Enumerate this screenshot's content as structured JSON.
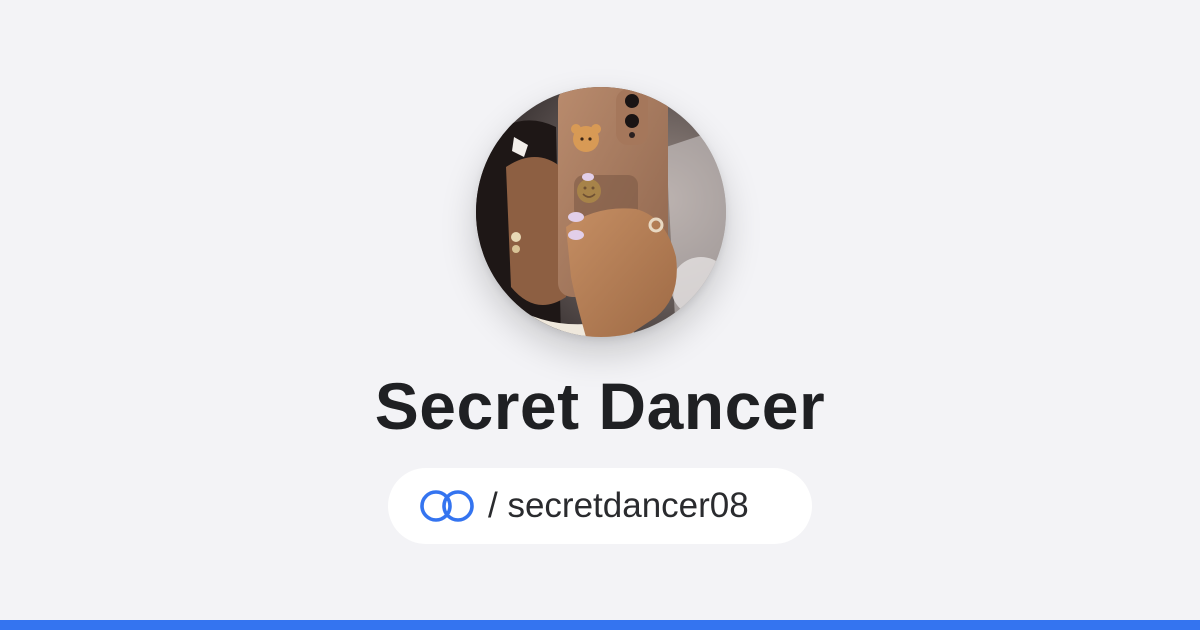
{
  "profile": {
    "display_name": "Secret Dancer",
    "handle_prefix": "/ ",
    "handle": "secretdancer08"
  },
  "icons": {
    "logo": "linked-rings-icon",
    "avatar": "profile-photo"
  },
  "colors": {
    "background": "#f3f3f6",
    "accent": "#3474f0",
    "text": "#1f2023",
    "pill": "#ffffff"
  }
}
